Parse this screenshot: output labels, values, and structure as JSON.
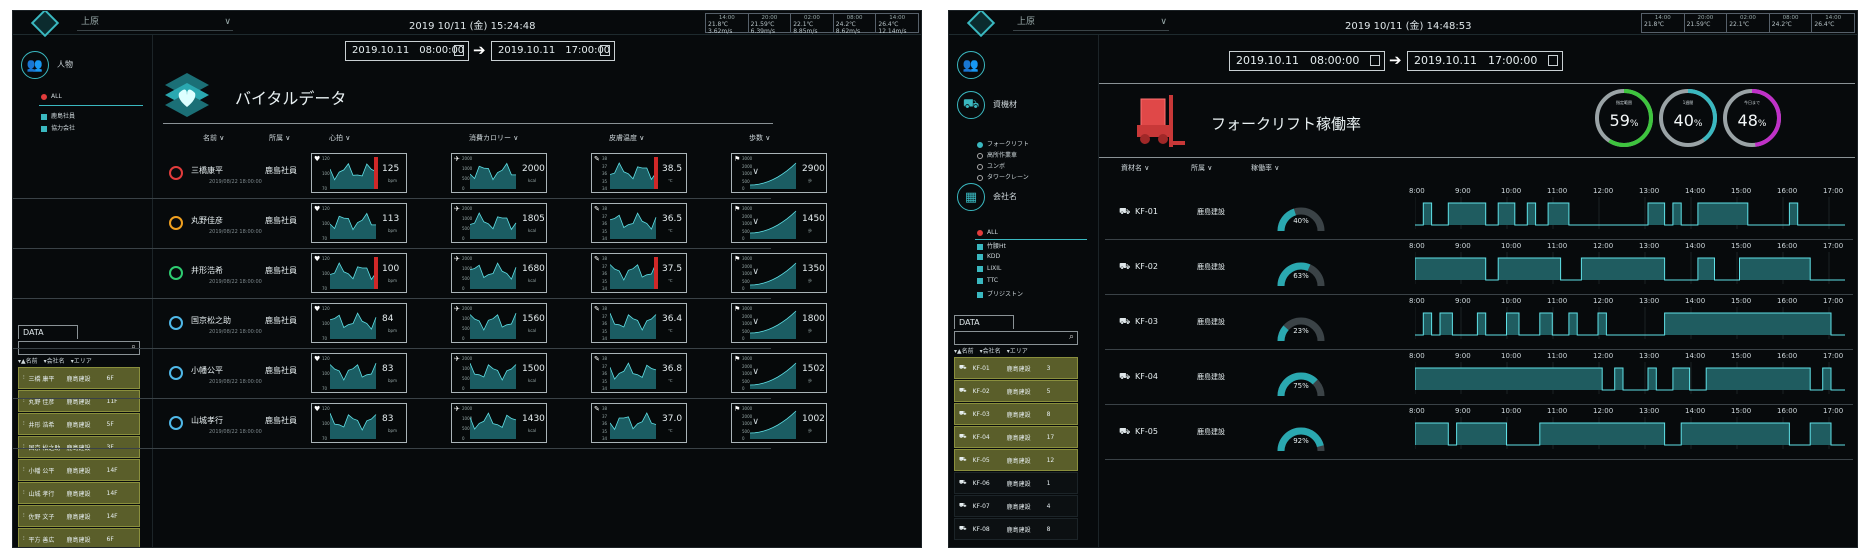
{
  "left_panel": {
    "topbar": {
      "site": "上原",
      "clock": "2019 10/11 (金) 15:24:48"
    },
    "weather": [
      {
        "time1": "14:00",
        "time2": "20:00",
        "v1": "21.8℃",
        "v2": "21.59℃",
        "v3": "3.62m/s",
        "v4": "6.39m/s"
      },
      {
        "time1": "02:00",
        "time2": "08:00",
        "v1": "22.1℃",
        "v2": "24.2℃",
        "v3": "8.85m/s",
        "v4": "8.62m/s"
      },
      {
        "time1": "14:00",
        "time2": "",
        "v1": "26.4℃",
        "v2": "",
        "v3": "12.14m/s",
        "v4": ""
      }
    ],
    "range": {
      "start": "2019.10.11　08:00:00",
      "end": "2019.10.11　17:00:00"
    },
    "sidebar": {
      "category": "人物",
      "options": [
        "ALL",
        "鹿島社員",
        "協力会社"
      ],
      "data_tab": "DATA",
      "data_header": [
        "名前",
        "会社名",
        "エリア"
      ],
      "rows": [
        [
          "三橋 康平",
          "鹿島建設",
          "6F"
        ],
        [
          "丸野 佳彦",
          "鹿島建設",
          "11F"
        ],
        [
          "井形 浩希",
          "鹿島建設",
          "5F"
        ],
        [
          "国京 松之助",
          "鹿島建設",
          "3F"
        ],
        [
          "小幡 公平",
          "鹿島建設",
          "14F"
        ],
        [
          "山城 孝行",
          "鹿島建設",
          "14F"
        ],
        [
          "佐野 文子",
          "鹿島建設",
          "14F"
        ],
        [
          "平方 善広",
          "鹿島建設",
          "6F"
        ]
      ]
    },
    "title": "バイタルデータ",
    "columns": [
      "名前",
      "所属",
      "心拍",
      "消費カロリー",
      "皮膚温度",
      "歩数"
    ],
    "axis": {
      "hr": [
        "120",
        "100",
        "70"
      ],
      "cal": [
        "2000",
        "1000",
        "500",
        "0"
      ],
      "temp": [
        "38",
        "37",
        "36",
        "35",
        "34"
      ],
      "steps": [
        "3000",
        "2000",
        "1000",
        "500",
        "0"
      ]
    },
    "units": {
      "hr": "bpm",
      "cal": "kcal",
      "temp": "℃",
      "steps": "歩"
    },
    "people": [
      {
        "name": "三橋康平",
        "org": "鹿島社員",
        "date": "2019/08/22 18:00:00",
        "hr": "125",
        "cal": "2000",
        "temp": "38.5",
        "steps": "2900",
        "face_color": "#e23c3c",
        "alert": true
      },
      {
        "name": "丸野佳彦",
        "org": "鹿島社員",
        "date": "2019/08/22 18:00:00",
        "hr": "113",
        "cal": "1805",
        "temp": "36.5",
        "steps": "1450",
        "face_color": "#f0a020",
        "alert": false
      },
      {
        "name": "井形浩希",
        "org": "鹿島社員",
        "date": "2019/08/22 18:00:00",
        "hr": "100",
        "cal": "1680",
        "temp": "37.5",
        "steps": "1350",
        "face_color": "#2ecc71",
        "alert": true
      },
      {
        "name": "国京松之助",
        "org": "鹿島社員",
        "date": "2019/08/22 18:00:00",
        "hr": "84",
        "cal": "1560",
        "temp": "36.4",
        "steps": "1800",
        "face_color": "#4fb8e8",
        "alert": false
      },
      {
        "name": "小幡公平",
        "org": "鹿島社員",
        "date": "2019/08/22 18:00:00",
        "hr": "83",
        "cal": "1500",
        "temp": "36.8",
        "steps": "1502",
        "face_color": "#4fb8e8",
        "alert": false
      },
      {
        "name": "山城孝行",
        "org": "鹿島社員",
        "date": "2019/08/22 18:00:00",
        "hr": "83",
        "cal": "1430",
        "temp": "37.0",
        "steps": "1002",
        "face_color": "#4fb8e8",
        "alert": false
      }
    ]
  },
  "right_panel": {
    "topbar": {
      "site": "上原",
      "clock": "2019 10/11 (金) 14:48:53"
    },
    "range": {
      "start": "2019.10.11　08:00:00",
      "end": "2019.10.11　17:00:00"
    },
    "sidebar": {
      "cat1": "資機材",
      "cat1_options": [
        "フォークリフト",
        "高所作業車",
        "ユンボ",
        "タワークレーン"
      ],
      "cat2": "会社名",
      "cat2_options": [
        "ALL",
        "竹腰Ht",
        "KDD",
        "LIXIL",
        "TTC",
        "ブリジストン"
      ],
      "data_tab": "DATA",
      "data_header": [
        "名前",
        "会社名",
        "エリア"
      ],
      "rows": [
        [
          "KF-01",
          "鹿島建設",
          "3",
          true
        ],
        [
          "KF-02",
          "鹿島建設",
          "5",
          true
        ],
        [
          "KF-03",
          "鹿島建設",
          "8",
          true
        ],
        [
          "KF-04",
          "鹿島建設",
          "17",
          true
        ],
        [
          "KF-05",
          "鹿島建設",
          "12",
          true
        ],
        [
          "KF-06",
          "鹿島建設",
          "1",
          false
        ],
        [
          "KF-07",
          "鹿島建設",
          "4",
          false
        ],
        [
          "KF-08",
          "鹿島建設",
          "8",
          false
        ]
      ]
    },
    "title": "フォークリフト稼働率",
    "gauges": [
      {
        "label": "指定範囲",
        "value": "59",
        "frac": 0.59,
        "color": "#3ec43e"
      },
      {
        "label": "1週間",
        "value": "40",
        "frac": 0.4,
        "color": "#3ab8c0"
      },
      {
        "label": "今日まで",
        "value": "48",
        "frac": 0.48,
        "color": "#c030c8"
      }
    ],
    "columns": [
      "資材名",
      "所属",
      "稼働率"
    ],
    "hours": [
      "8:00",
      "9:00",
      "10:00",
      "11:00",
      "12:00",
      "13:00",
      "14:00",
      "15:00",
      "16:00",
      "17:00"
    ],
    "machines": [
      {
        "name": "KF-01",
        "org": "鹿島建設",
        "rate": "40%",
        "frac": 0.4
      },
      {
        "name": "KF-02",
        "org": "鹿島建設",
        "rate": "63%",
        "frac": 0.63
      },
      {
        "name": "KF-03",
        "org": "鹿島建設",
        "rate": "23%",
        "frac": 0.23
      },
      {
        "name": "KF-04",
        "org": "鹿島建設",
        "rate": "75%",
        "frac": 0.75
      },
      {
        "name": "KF-05",
        "org": "鹿島建設",
        "rate": "92%",
        "frac": 0.92
      }
    ]
  }
}
